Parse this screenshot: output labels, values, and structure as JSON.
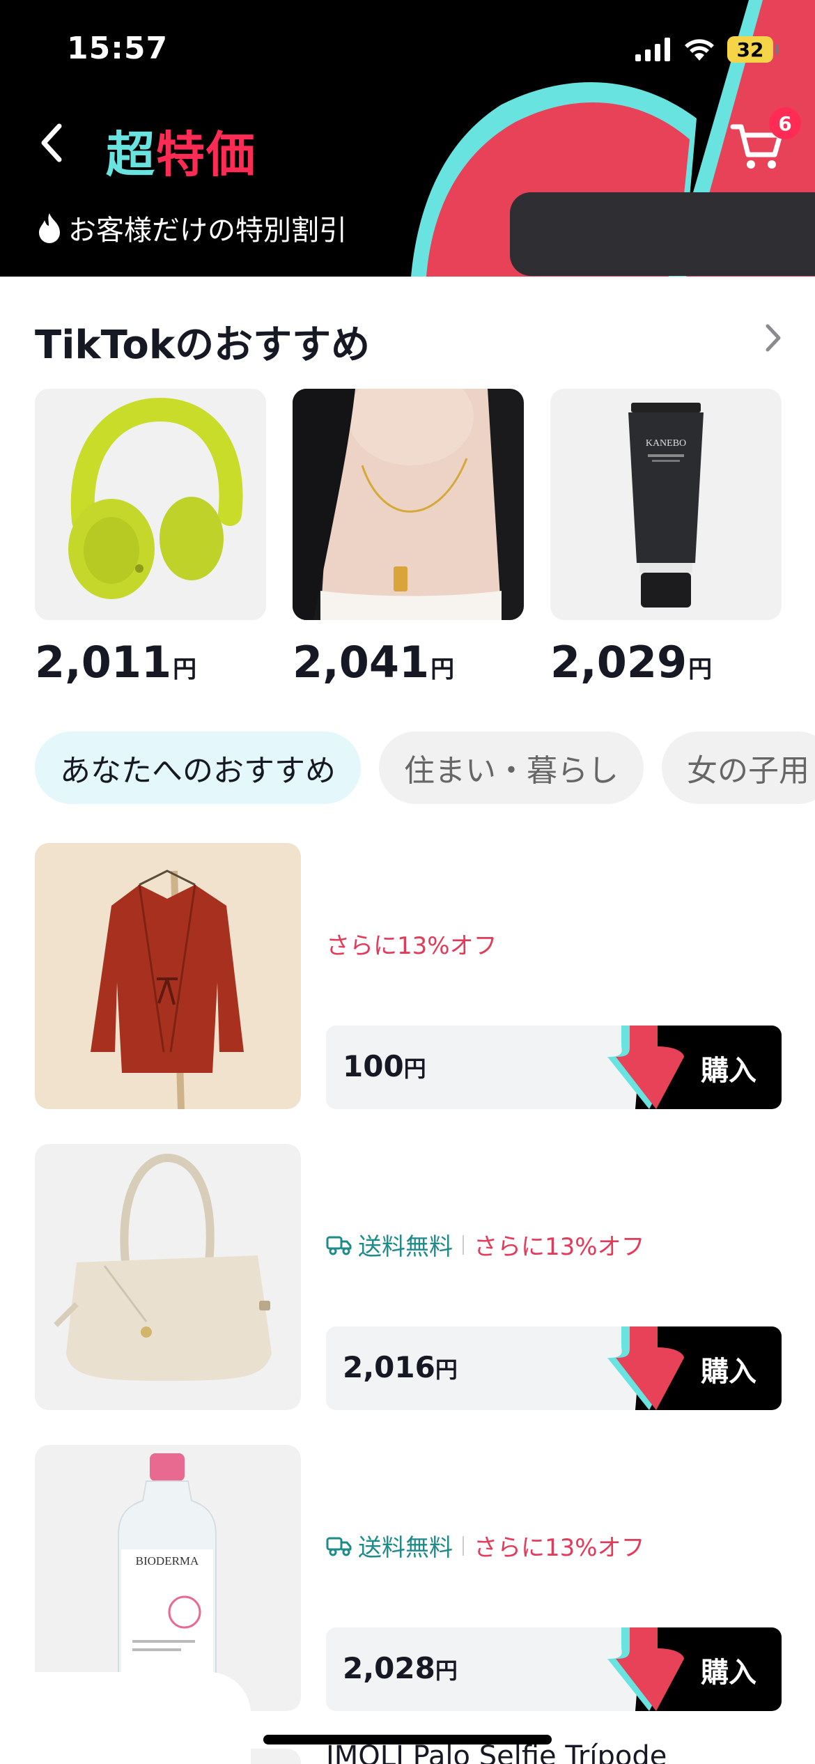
{
  "status": {
    "time": "15:57",
    "battery": "32"
  },
  "header": {
    "title_part1": "超",
    "title_part2": "特価",
    "subtitle": "お客様だけの特別割引",
    "cart_count": "6",
    "colors": {
      "cyan": "#69e3e0",
      "red": "#fe2c55",
      "bg": "#000000"
    }
  },
  "recommend": {
    "title": "TikTokのおすすめ",
    "items": [
      {
        "price": "2,011",
        "unit": "円",
        "image": "yellow-headphones"
      },
      {
        "price": "2,041",
        "unit": "円",
        "image": "gold-necklace"
      },
      {
        "price": "2,029",
        "unit": "円",
        "image": "black-cream-tube",
        "brand": "KANEBO"
      }
    ]
  },
  "tabs": [
    {
      "label": "あなたへのおすすめ",
      "active": true
    },
    {
      "label": "住まい・暮らし",
      "active": false
    },
    {
      "label": "女の子用",
      "active": false
    }
  ],
  "products": [
    {
      "image": "red-cardigan",
      "free_shipping": false,
      "ship_label": "",
      "discount": "さらに13%オフ",
      "price": "100",
      "unit": "円",
      "buy": "購入"
    },
    {
      "image": "cream-handbag",
      "free_shipping": true,
      "ship_label": "送料無料",
      "discount": "さらに13%オフ",
      "price": "2,016",
      "unit": "円",
      "buy": "購入"
    },
    {
      "image": "micellar-water-bottle",
      "brand": "BIODERMA",
      "free_shipping": true,
      "ship_label": "送料無料",
      "discount": "さらに13%オフ",
      "price": "2,028",
      "unit": "円",
      "buy": "購入"
    }
  ],
  "next_product_title": "IMOLI Palo Selfie Trípode"
}
